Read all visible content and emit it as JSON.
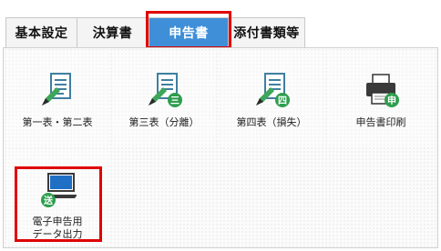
{
  "tabs": [
    {
      "label": "基本設定",
      "active": false
    },
    {
      "label": "決算書",
      "active": false
    },
    {
      "label": "申告書",
      "active": true
    },
    {
      "label": "添付書類等",
      "active": false
    }
  ],
  "menu": [
    {
      "label": "第一表・第二表",
      "icon": "document-pen-icon"
    },
    {
      "label": "第三表（分離）",
      "icon": "document-pen-three-icon",
      "badge": "三"
    },
    {
      "label": "第四表（損失）",
      "icon": "document-pen-four-icon",
      "badge": "四"
    },
    {
      "label": "申告書印刷",
      "icon": "printer-icon",
      "badge": "申"
    },
    {
      "label_line1": "電子申告用",
      "label_line2": "データ出力",
      "icon": "laptop-send-icon",
      "badge": "送"
    }
  ],
  "colors": {
    "accent": "#3f8fd8",
    "highlight": "#e00000",
    "badge": "#2e9e4f"
  }
}
